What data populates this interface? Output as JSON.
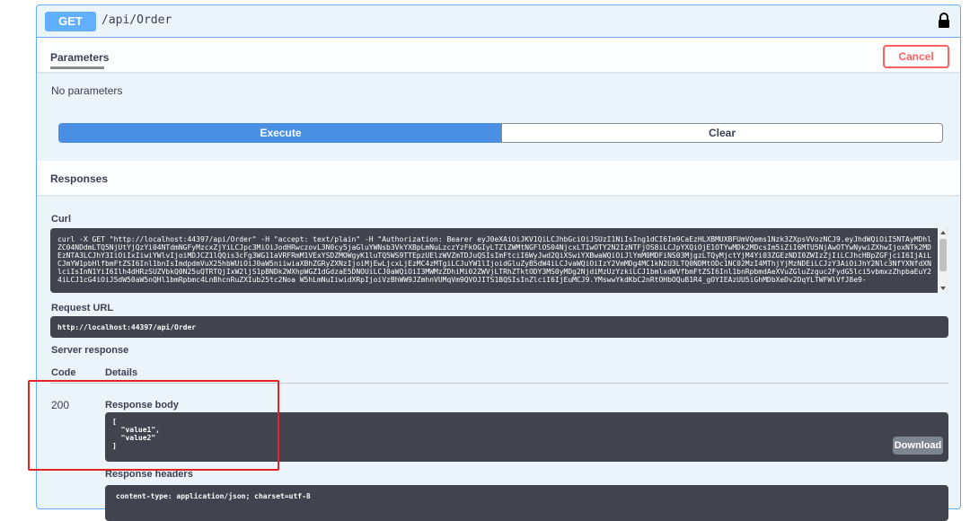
{
  "operation": {
    "method": "GET",
    "path": "/api/Order",
    "lock_icon": "lock-icon"
  },
  "parameters": {
    "title": "Parameters",
    "cancel_label": "Cancel",
    "empty_text": "No parameters"
  },
  "actions": {
    "execute_label": "Execute",
    "clear_label": "Clear"
  },
  "responses": {
    "title": "Responses",
    "curl_label": "Curl",
    "curl_text": "curl -X GET \"http://localhost:44397/api/Order\" -H \"accept: text/plain\" -H \"Authorization: Bearer eyJ0eXAiOiJKV1QiLCJhbGciOiJSUzI1NiIsIng1dCI6Im9CaEzHLXBMUXBFUmVQems1Nzk3ZXpsVVozNCJ9.eyJhdWQiOiI5NTAyMDhlZC04NDdmLTQ5NjUtYjQzYi04NTdmNGFyMzcxZjYiLCJpc3MiOiJodHRwczovL3N0cy5jaGluYWNsb3VkYXBpLmNuLzczYzFkOGIyLTZlZWMtNGFlOS04NjcxLTIwOTY2N2IzNTFjOS8iLCJpYXQiOjE1OTYwMDk2MDcsIm5iZiI6MTU5NjAwOTYwNywiZXhwIjoxNTk2MDEzNTA3LCJhY3IiOiIxIiwiYWlvIjoiMDJCZ1lQQis3cFg3WG11aVRFRmM1VExYSDZMOWgyK1luTQ5WS9TTEpzUElzWVZmTDJuQSIsImFtciI6WyJwd2QiXSwiYXBwaWQiOiJlYmM0MDFiNS03MjgzLTQyMjctYjM4Yi03ZGEzNDI0ZWIzZjIiLCJhcHBpZGFjciI6IjAiLCJmYW1pbHlfbmFtZSI6Inl1bnIsImdpdmVuX25hbWUiOiJ0aW5niiwiaXBhZGRyZXNzIjoiMjEwLjcxLjEzMC4zMTgiLCJuYW1lIjoidGluZyB5dW4iLCJvaWQiOiIzY2VmMDg4MC1kN2U3LTQ0NDMtODc1NC02MzI4MThjYjMzNDEiLCJzY3AiOiJhY2Nlc3NfYXNfdXNlciIsInN1YiI6Ilh4dHRzSUZVbkQ0N25uQTRTQjIxW2ljS1pBNDk2WXhpWGZ1dGdzaE5DNOUiLCJ0aWQiOiI3MWMzZDhiMi02ZWVjLTRhZTktODY3MS0yMDg2NjdiMzUzYzkiLCJ1bmlxdWVfbmFtZSI6Inl1bnRpbmdAeXVuZGluZzguc2FydG5lci5vbmxzZhpbaEuY24iLCJ1cG4iOiJ5dW50aW5nQHl1bmRpbmc4LnBhcnRuZXIub25tc2Noa W5hLmNuIiwidXRpIjoiVzBhWW9JZmhnVUMqVm9QVOJITS1BQSIsInZlciI6IjEuMCJ9.YMswwYkdKbC2nRtOHbOQuB1R4_gOYIEAzUU5iGhMDbXeDv2DqYLTWFWlVfJ8e9-",
    "request_url_label": "Request URL",
    "request_url": "http://localhost:44397/api/Order",
    "server_response_label": "Server response",
    "code_header": "Code",
    "details_header": "Details",
    "code_value": "200",
    "body_label": "Response body",
    "body_text": "[\n  \"value1\",\n  \"value2\"\n]",
    "download_label": "Download",
    "headers_label": "Response headers",
    "headers_text": "content-type: application/json; charset=utf-8"
  }
}
